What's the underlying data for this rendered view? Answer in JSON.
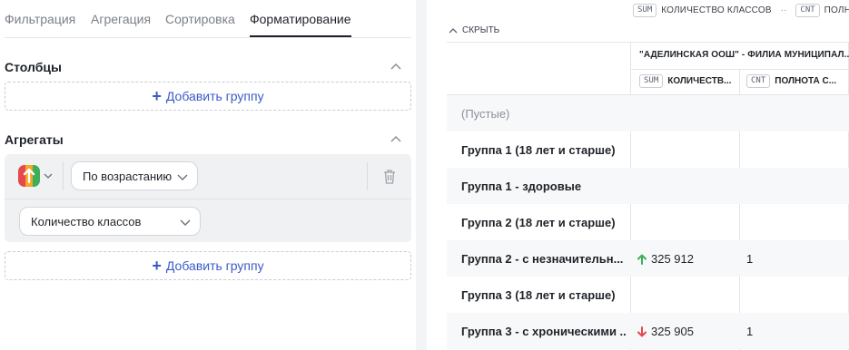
{
  "tabs": [
    {
      "label": "Фильтрация",
      "active": false
    },
    {
      "label": "Агрегация",
      "active": false
    },
    {
      "label": "Сортировка",
      "active": false
    },
    {
      "label": "Форматирование",
      "active": true
    }
  ],
  "columns_section": {
    "title": "Столбцы",
    "add_group_label": "Добавить группу"
  },
  "aggregates_section": {
    "title": "Агрегаты",
    "sort_select": {
      "value": "По возрастанию"
    },
    "measure_select": {
      "value": "Количество классов"
    },
    "add_group_label": "Добавить группу",
    "color_scheme": [
      "#e5484d",
      "#f5a623",
      "#3fae5a"
    ]
  },
  "table": {
    "top_measures": [
      {
        "badge": "SUM",
        "label": "КОЛИЧЕСТВО КЛАССОВ"
      },
      {
        "badge": "CNT",
        "label": "ПОЛН"
      }
    ],
    "hide_label": "СКРЫТЬ",
    "group_header": "\"АДЕЛИНСКАЯ ООШ\" - ФИЛИА МУНИЦИПАЛ...",
    "columns": [
      {
        "badge": "SUM",
        "label": "КОЛИЧЕСТВ..."
      },
      {
        "badge": "CNT",
        "label": "ПОЛНОТА С..."
      }
    ],
    "rows": [
      {
        "label": "(Пустые)",
        "empty": true,
        "value": "",
        "trend": "",
        "count": ""
      },
      {
        "label": "Группа 1 (18 лет и старше)",
        "empty": false,
        "value": "",
        "trend": "",
        "count": ""
      },
      {
        "label": "Группа 1 - здоровые",
        "empty": false,
        "value": "",
        "trend": "",
        "count": ""
      },
      {
        "label": "Группа 2 (18 лет и старше)",
        "empty": false,
        "value": "",
        "trend": "",
        "count": ""
      },
      {
        "label": "Группа 2 - с незначительн...",
        "empty": false,
        "value": "325 912",
        "trend": "up",
        "count": "1"
      },
      {
        "label": "Группа 3 (18 лет и старше)",
        "empty": false,
        "value": "",
        "trend": "",
        "count": ""
      },
      {
        "label": "Группа 3 - с хроническими ...",
        "empty": false,
        "value": "325 905",
        "trend": "down",
        "count": "1"
      }
    ],
    "trend_colors": {
      "up": "#3fae5a",
      "down": "#e5484d"
    }
  }
}
